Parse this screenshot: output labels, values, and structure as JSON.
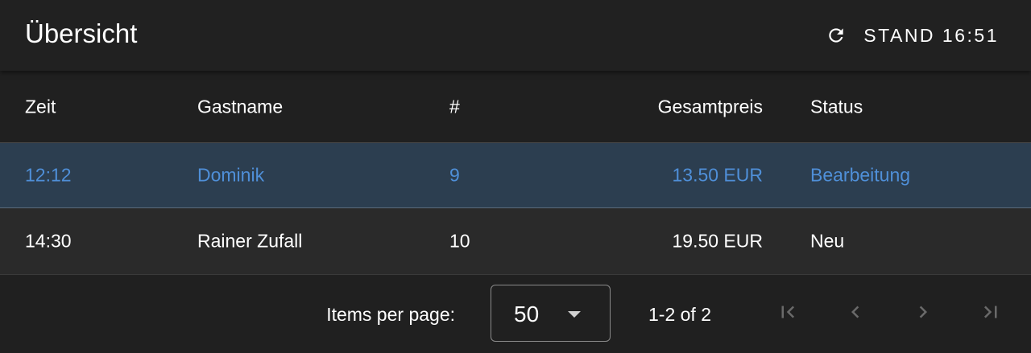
{
  "header": {
    "title": "Übersicht",
    "refresh_icon": "refresh-icon",
    "refresh_label": "STAND 16:51"
  },
  "table": {
    "columns": [
      "Zeit",
      "Gastname",
      "#",
      "Gesamtpreis",
      "Status"
    ],
    "rows": [
      {
        "zeit": "12:12",
        "gastname": "Dominik",
        "anzahl": "9",
        "gesamtpreis": "13.50 EUR",
        "status": "Bearbeitung",
        "selected": true
      },
      {
        "zeit": "14:30",
        "gastname": "Rainer Zufall",
        "anzahl": "10",
        "gesamtpreis": "19.50 EUR",
        "status": "Neu",
        "selected": false
      }
    ]
  },
  "paginator": {
    "items_per_page_label": "Items per page:",
    "page_size": "50",
    "range_label": "1-2 of 2",
    "icons": [
      "first-page-icon",
      "previous-page-icon",
      "next-page-icon",
      "last-page-icon"
    ]
  },
  "colors": {
    "background": "#202020",
    "selected_row": "#2c3e50",
    "selected_text": "#4f8fd8",
    "disabled_icon": "#6a6a6a"
  }
}
